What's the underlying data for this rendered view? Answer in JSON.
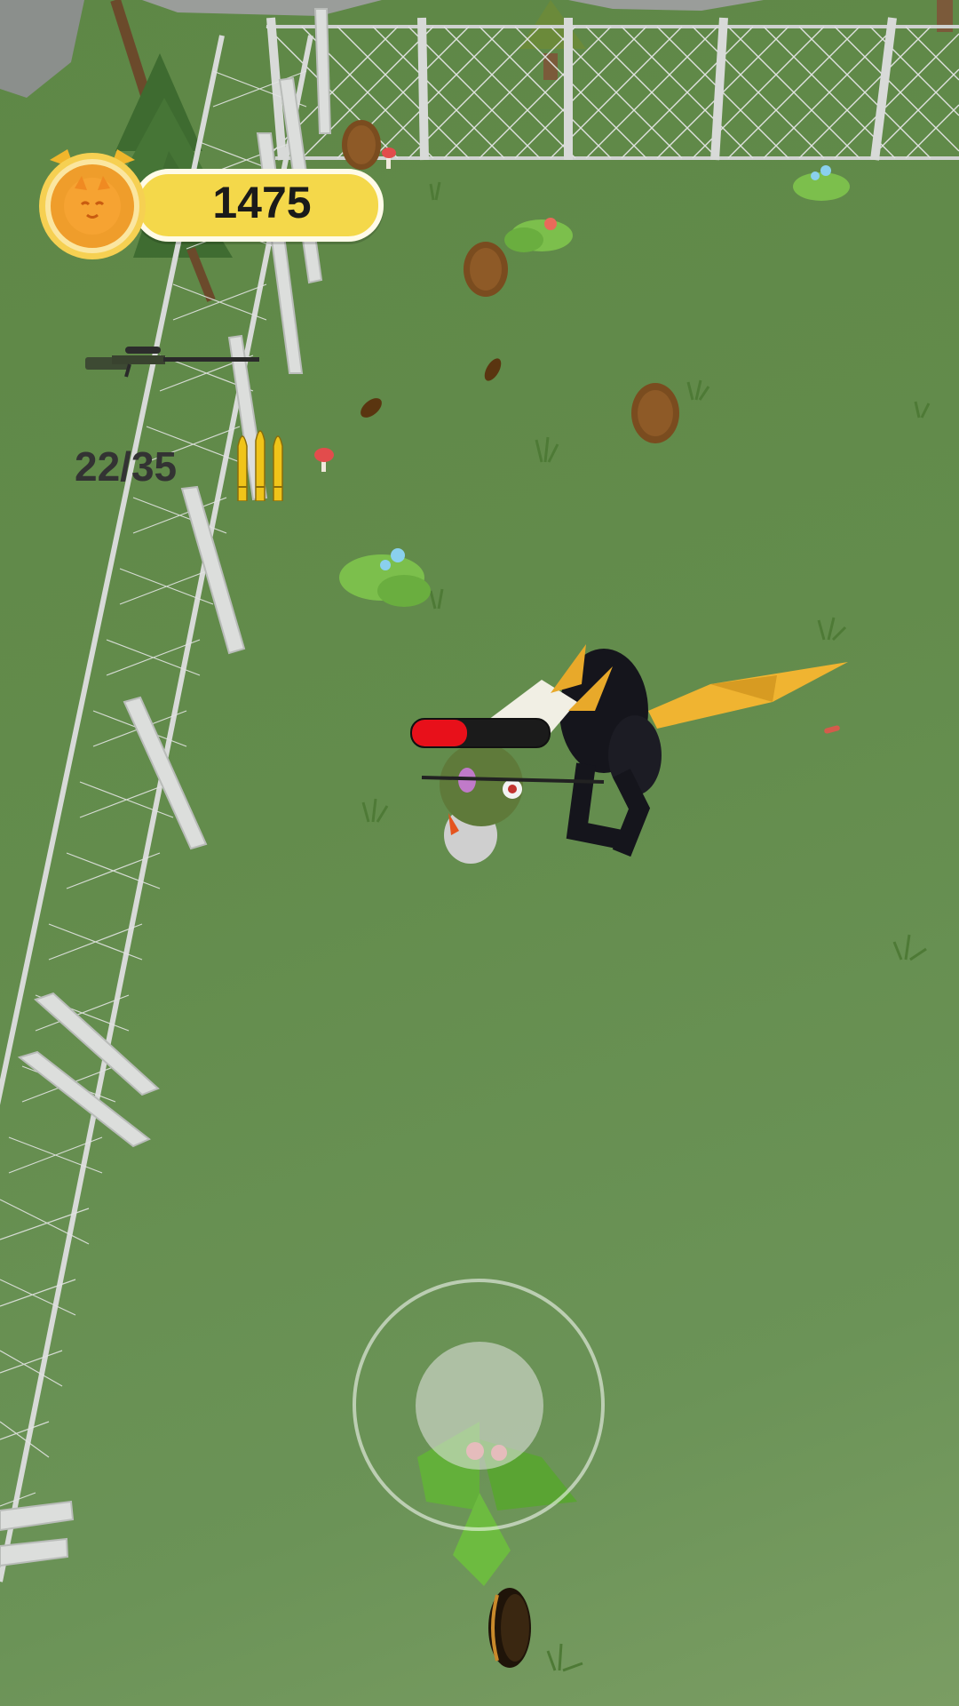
{
  "hud": {
    "coins": "1475",
    "ammo": "22/35",
    "coin_icon": "cat-coin-icon",
    "weapon_icon": "sniper-rifle-icon",
    "ammo_icon": "bullets-icon"
  },
  "player": {
    "health_fraction": 0.4
  },
  "joystick": {
    "icon": "virtual-joystick"
  },
  "colors": {
    "grass": "#638c4c",
    "coin_bar": "#f4d84a",
    "health": "#e8101a"
  }
}
